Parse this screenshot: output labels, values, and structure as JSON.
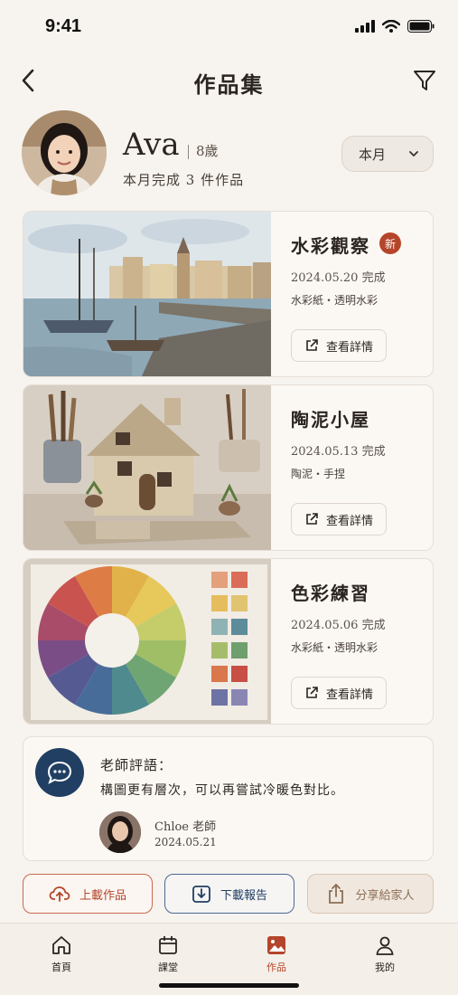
{
  "status_bar": {
    "time": "9:41"
  },
  "header": {
    "title": "作品集"
  },
  "profile": {
    "name": "Ava",
    "age": "8歲",
    "summary": "本月完成 3 件作品",
    "period_select": "本月"
  },
  "works": [
    {
      "title": "水彩觀察",
      "badge": "新",
      "date": "2024.05.20 完成",
      "materials": "水彩紙・透明水彩",
      "detail_label": "查看詳情"
    },
    {
      "title": "陶泥小屋",
      "badge": "",
      "date": "2024.05.13 完成",
      "materials": "陶泥・手捏",
      "detail_label": "查看詳情"
    },
    {
      "title": "色彩練習",
      "badge": "",
      "date": "2024.05.06 完成",
      "materials": "水彩紙・透明水彩",
      "detail_label": "查看詳情"
    }
  ],
  "comment": {
    "heading": "老師評語：",
    "text": "構圖更有層次，可以再嘗試冷暖色對比。",
    "teacher": "Chloe 老師",
    "date": "2024.05.21"
  },
  "actions": {
    "upload": "上載作品",
    "download": "下載報告",
    "share": "分享給家人"
  },
  "tabs": [
    {
      "label": "首頁",
      "icon": "home-icon"
    },
    {
      "label": "課堂",
      "icon": "calendar-icon"
    },
    {
      "label": "作品",
      "icon": "image-icon",
      "active": true
    },
    {
      "label": "我的",
      "icon": "user-icon"
    }
  ],
  "colors": {
    "accent": "#b5452a",
    "navy": "#213f63",
    "background": "#f7f3ee"
  }
}
